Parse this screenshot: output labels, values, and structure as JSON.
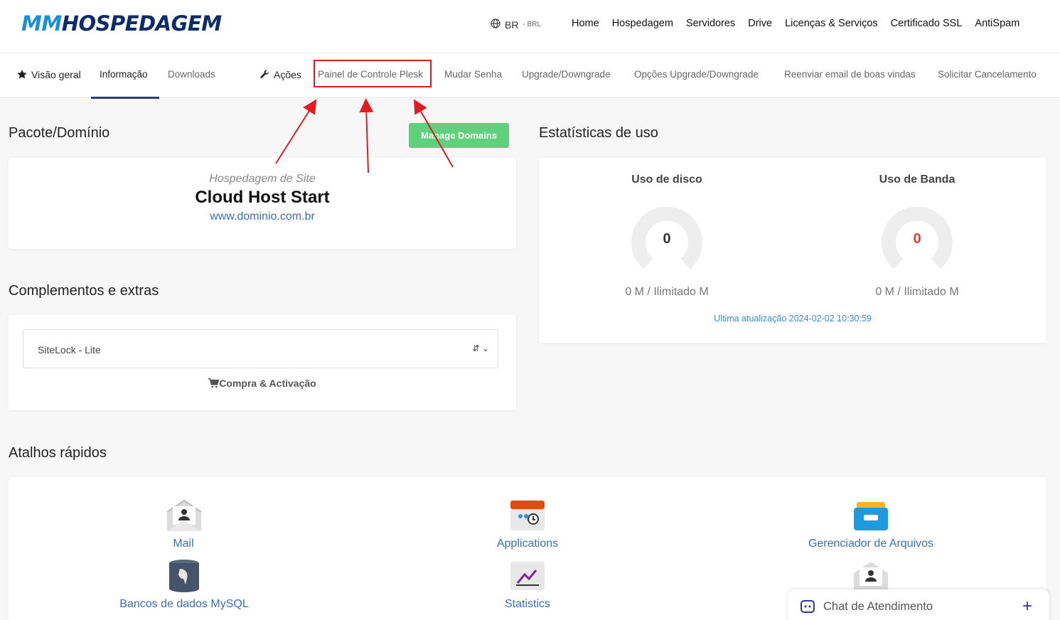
{
  "logo": {
    "part1": "MM",
    "part2": "HOSPEDAGEM"
  },
  "header": {
    "lang_code": "BR",
    "currency": "- BRL",
    "nav": [
      "Home",
      "Hospedagem",
      "Servidores",
      "Drive",
      "Licenças & Serviços",
      "Certificado SSL",
      "AntiSpam"
    ]
  },
  "tabs": {
    "overview": "Visão geral",
    "info": "Informação",
    "downloads": "Downloads",
    "actions": "Ações",
    "plesk": "Painel de Controle Plesk",
    "change_password": "Mudar Senha",
    "upgrade": "Upgrade/Downgrade",
    "upgrade_options": "Opções Upgrade/Downgrade",
    "resend_email": "Reenviar email de boas vindas",
    "cancel": "Solicitar Cancelamento"
  },
  "package": {
    "heading": "Pacote/Domínio",
    "manage_button": "Manage Domains",
    "group": "Hospedagem de Site",
    "name": "Cloud Host Start",
    "domain": "www.dominio.com.br"
  },
  "stats": {
    "heading": "Estatísticas de uso",
    "disk_title": "Uso de disco",
    "disk_value": "0",
    "disk_label": "0 M / Ilimitado M",
    "band_title": "Uso de Banda",
    "band_value": "0",
    "band_label": "0 M / Ilimitado M",
    "updated": "Ultima atualização 2024-02-02 10:30:59"
  },
  "addons": {
    "heading": "Complementos e extras",
    "selected": "SiteLock - Lite",
    "buy_label": "Compra & Activação"
  },
  "shortcuts": {
    "heading": "Atalhos rápidos",
    "items": [
      "Mail",
      "Applications",
      "Gerenciador de Arquivos",
      "Bancos de dados MySQL",
      "Statistics"
    ]
  },
  "chat": {
    "label": "Chat de Atendimento"
  },
  "colors": {
    "accent_blue": "#1a8fd9",
    "navy": "#0d2b6b",
    "green": "#5fd07c",
    "highlight_red": "#e01b24"
  }
}
